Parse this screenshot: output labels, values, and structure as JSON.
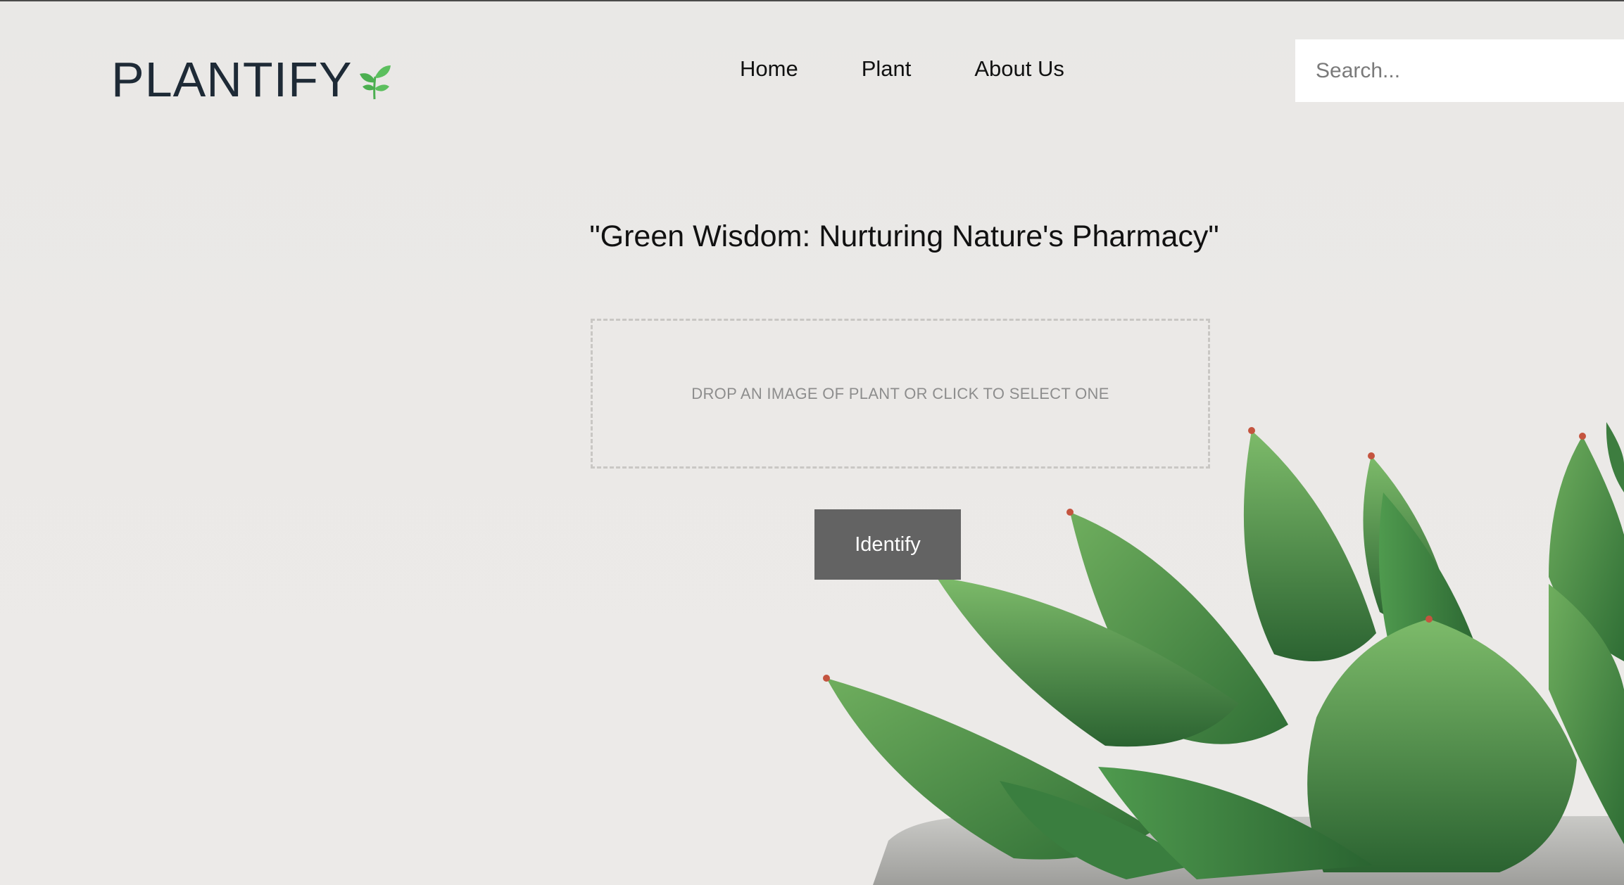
{
  "brand": {
    "name": "PLANTIFY",
    "icon": "sprout-icon",
    "icon_color": "#4caf50"
  },
  "nav": {
    "items": [
      {
        "label": "Home"
      },
      {
        "label": "Plant"
      },
      {
        "label": "About Us"
      }
    ]
  },
  "search": {
    "placeholder": "Search...",
    "value": ""
  },
  "hero": {
    "tagline": "\"Green Wisdom: Nurturing Nature's Pharmacy\"",
    "dropzone_text": "DROP AN IMAGE OF PLANT OR CLICK TO SELECT ONE",
    "identify_label": "Identify"
  },
  "colors": {
    "background": "#ebe9e7",
    "button": "#636363",
    "leaf_green": "#3f8a45"
  }
}
